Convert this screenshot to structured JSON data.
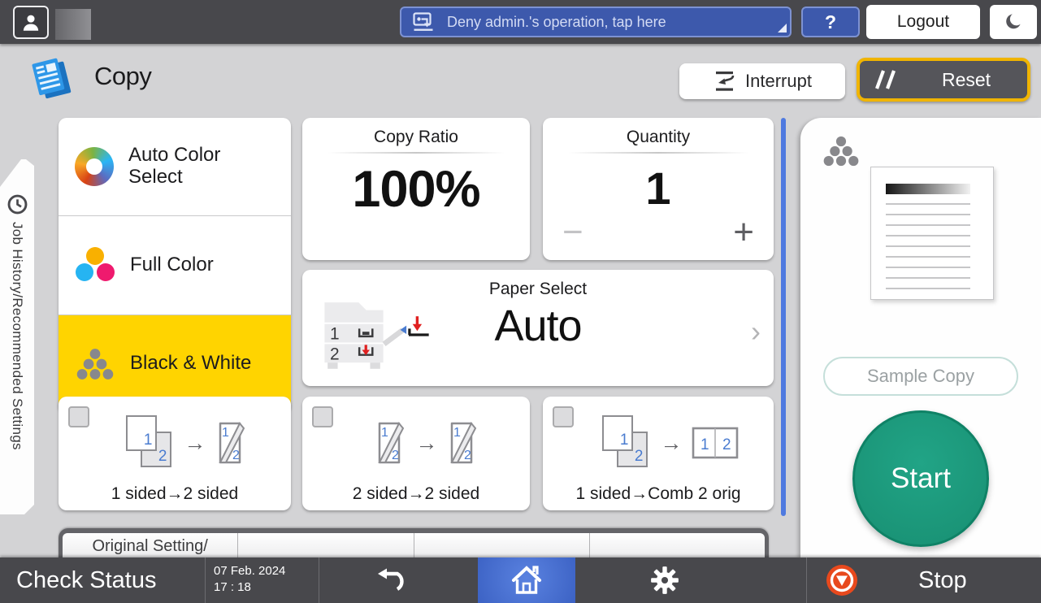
{
  "colors": {
    "bar_dark": "#48484c",
    "screen_bg": "#d3d3d5",
    "selected_yellow": "#ffd400",
    "reset_ring_yellow": "#f0b400",
    "notification_blue": "#3d59ac",
    "start_green": "#1a9a7d",
    "home_blue": "#3c62c4",
    "stop_orange": "#e8491d",
    "scrollbar_blue": "#4f7ae0",
    "page_number_blue": "#4a7cd0"
  },
  "top_bar": {
    "notification_text": "Deny admin.'s operation, tap here",
    "help_label": "?",
    "logout_label": "Logout"
  },
  "header": {
    "title": "Copy",
    "interrupt_label": "Interrupt",
    "reset_label": "Reset"
  },
  "sidebar_tab": {
    "label": "Job History/Recommended Settings"
  },
  "color_modes": [
    {
      "label": "Auto Color Select",
      "selected": false
    },
    {
      "label": "Full Color",
      "selected": false
    },
    {
      "label": "Black & White",
      "selected": true
    }
  ],
  "copy_ratio": {
    "label": "Copy Ratio",
    "value": "100%"
  },
  "quantity": {
    "label": "Quantity",
    "value": "1",
    "decrease": "−",
    "increase": "+"
  },
  "paper_select": {
    "label": "Paper Select",
    "value": "Auto",
    "tray_1": "1",
    "tray_2": "2",
    "chevron": "›"
  },
  "duplex_options": [
    {
      "label": "1 sided→2 sided",
      "arrow": "→",
      "n1": "1",
      "n2": "2",
      "checked": false
    },
    {
      "label": "2 sided→2 sided",
      "arrow": "→",
      "n1": "1",
      "n2": "2",
      "checked": false
    },
    {
      "label": "1 sided→Comb 2 orig",
      "arrow": "→",
      "n1": "1",
      "n2": "2",
      "checked": false
    }
  ],
  "settings_row": {
    "first_label": "Original Setting/"
  },
  "right_panel": {
    "color_mode_indicator": "black-and-white-dots",
    "sample_copy_label": "Sample Copy",
    "start_label": "Start"
  },
  "bottom_bar": {
    "check_status_label": "Check Status",
    "date": "07 Feb. 2024",
    "time": "17 : 18",
    "stop_label": "Stop"
  },
  "icons": {
    "user": "person silhouette",
    "admin_notification": "panel with arrow",
    "moon": "crescent / sleep mode",
    "copy_app": "blue document stack",
    "interrupt": "arrow between bars",
    "reset": "double slash",
    "job_history_clock": "clock",
    "auto_color": "color swirl",
    "full_color": "cyan-magenta-yellow dots",
    "black_white": "gray dot triangle",
    "paper_trays": "printer with tray 1 and 2",
    "back": "curved return arrow",
    "home": "house",
    "settings": "gear",
    "stop": "white triangle in orange circle"
  }
}
